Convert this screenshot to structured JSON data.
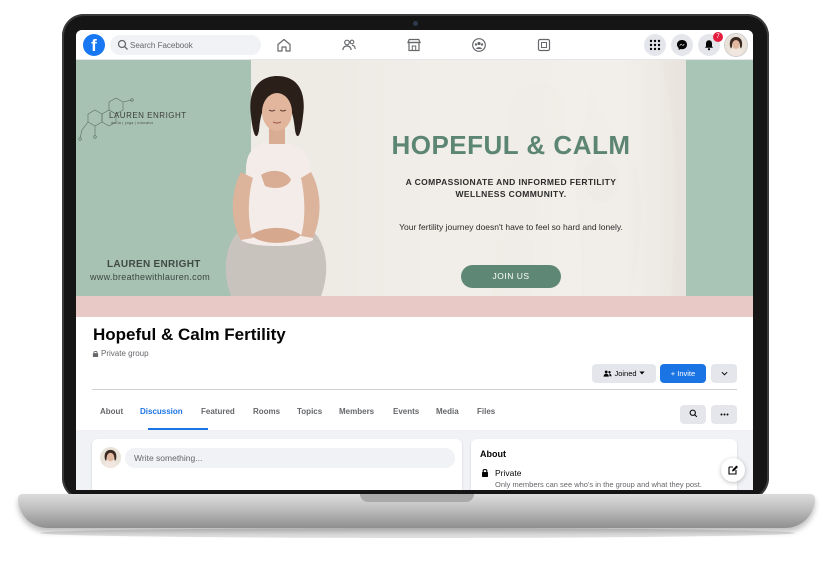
{
  "nav": {
    "logo_letter": "f",
    "search_placeholder": "Search Facebook",
    "notification_count": "7",
    "icons": [
      "home-icon",
      "friends-icon",
      "marketplace-icon",
      "groups-icon",
      "gaming-icon",
      "menu-grid-icon",
      "messenger-icon",
      "bell-icon"
    ]
  },
  "cover": {
    "logo_name": "LAUREN ENRIGHT",
    "logo_sub": "doula | yoga | educator",
    "name": "LAUREN ENRIGHT",
    "site": "www.breathewithlauren.com",
    "headline": "HOPEFUL & CALM",
    "tagline": "A COMPASSIONATE AND INFORMED FERTILITY WELLNESS COMMUNITY.",
    "journey": "Your fertility journey doesn't have to feel so hard and lonely.",
    "join_label": "JOIN US"
  },
  "group": {
    "title": "Hopeful & Calm Fertility",
    "privacy": "Private group",
    "joined_label": "Joined",
    "invite_label": "+ Invite",
    "tabs": [
      "About",
      "Discussion",
      "Featured",
      "Rooms",
      "Topics",
      "Members",
      "Events",
      "Media",
      "Files"
    ],
    "active_tab": "Discussion"
  },
  "composer": {
    "placeholder": "Write something..."
  },
  "about": {
    "title": "About",
    "private_label": "Private",
    "private_desc": "Only members can see who's in the group and what they post."
  },
  "colors": {
    "brand_blue": "#1877f2",
    "accent_blue": "#1b74e4",
    "cover_green": "#5f8776",
    "cover_pink": "#e9c9c5",
    "notification_red": "#e41e3f"
  }
}
